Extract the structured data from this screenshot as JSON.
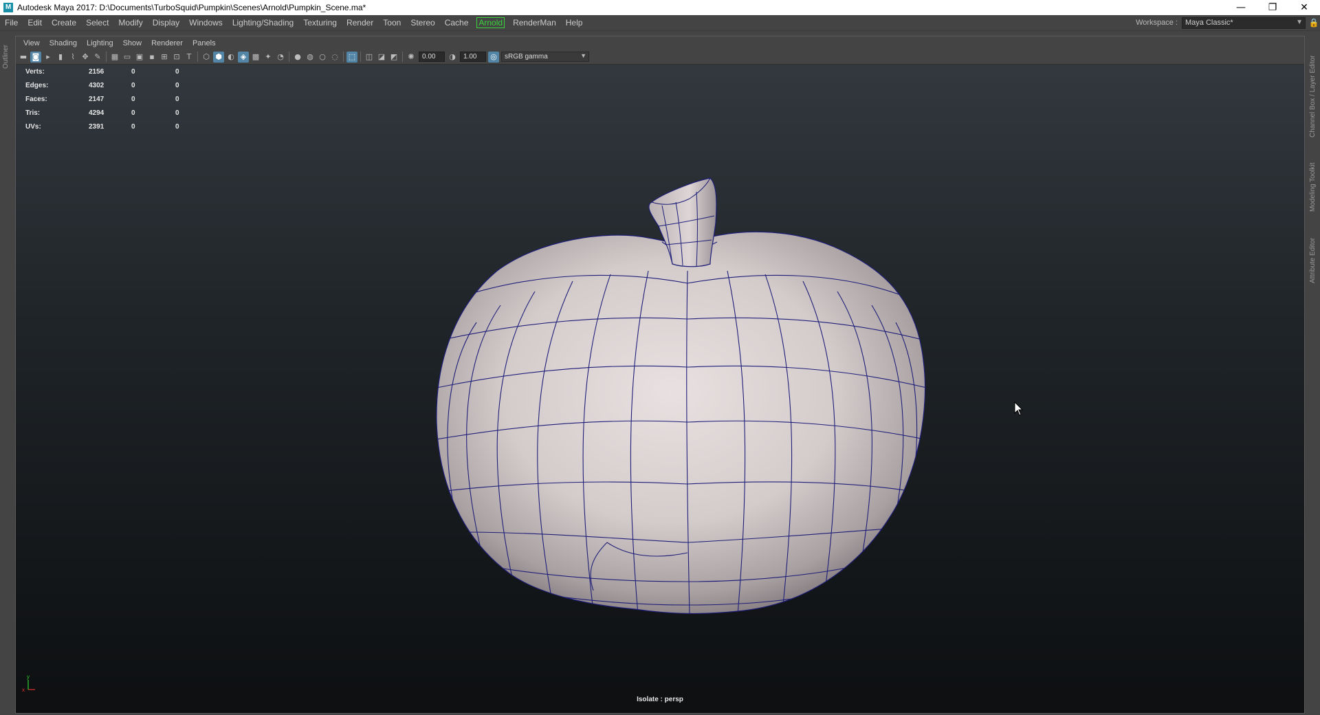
{
  "window": {
    "title": "Autodesk Maya 2017: D:\\Documents\\TurboSquid\\Pumpkin\\Scenes\\Arnold\\Pumpkin_Scene.ma*",
    "app_icon": "M",
    "controls": {
      "minimize": "—",
      "restore": "❐",
      "close": "✕"
    }
  },
  "menubar": {
    "items": [
      "File",
      "Edit",
      "Create",
      "Select",
      "Modify",
      "Display",
      "Windows",
      "Lighting/Shading",
      "Texturing",
      "Render",
      "Toon",
      "Stereo",
      "Cache",
      "Arnold",
      "RenderMan",
      "Help"
    ],
    "accent_arnold": "#3bd53b"
  },
  "workspace": {
    "label": "Workspace :",
    "value": "Maya Classic*"
  },
  "left_strip": {
    "tab": "Outliner"
  },
  "right_strip": {
    "tabs": [
      "Channel Box / Layer Editor",
      "Modeling Toolkit",
      "Attribute Editor"
    ]
  },
  "panel": {
    "menu": [
      "View",
      "Shading",
      "Lighting",
      "Show",
      "Renderer",
      "Panels"
    ],
    "toolbar": {
      "exposure": "0.00",
      "gamma": "1.00",
      "color_space": "sRGB gamma"
    }
  },
  "hud": {
    "rows": [
      {
        "label": "Verts:",
        "v1": "2156",
        "v2": "0",
        "v3": "0"
      },
      {
        "label": "Edges:",
        "v1": "4302",
        "v2": "0",
        "v3": "0"
      },
      {
        "label": "Faces:",
        "v1": "2147",
        "v2": "0",
        "v3": "0"
      },
      {
        "label": "Tris:",
        "v1": "4294",
        "v2": "0",
        "v3": "0"
      },
      {
        "label": "UVs:",
        "v1": "2391",
        "v2": "0",
        "v3": "0"
      }
    ]
  },
  "viewport": {
    "isolate_label": "Isolate : persp",
    "axis": {
      "x": "x",
      "y": "y"
    },
    "wire_color": "#1e1e78",
    "mesh_color": "#d8d0d0"
  }
}
